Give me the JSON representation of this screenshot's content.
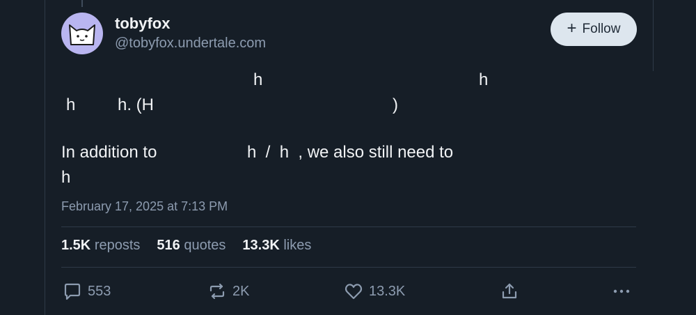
{
  "author": {
    "name": "tobyfox",
    "handle": "@tobyfox.undertale.com"
  },
  "follow_button": {
    "plus": "+",
    "label": "Follow"
  },
  "post_text": {
    "line1_a": "h",
    "line1_b": "h",
    "line2_a": "h",
    "line2_b": "h. (H",
    "line2_c": ")",
    "para2_a": "In addition to",
    "para2_b": "h  /  h  , we also still need to",
    "para2_c": "h"
  },
  "timestamp": "February 17, 2025 at 7:13 PM",
  "stats": {
    "reposts_count": "1.5K",
    "reposts_label": "reposts",
    "quotes_count": "516",
    "quotes_label": "quotes",
    "likes_count": "13.3K",
    "likes_label": "likes"
  },
  "actions": {
    "reply_count": "553",
    "repost_count": "2K",
    "like_count": "13.3K"
  },
  "icons": {
    "reply": "speech-bubble-icon",
    "repost": "repost-arrows-icon",
    "like": "heart-icon",
    "share": "share-upload-icon",
    "more": "ellipsis-icon"
  }
}
